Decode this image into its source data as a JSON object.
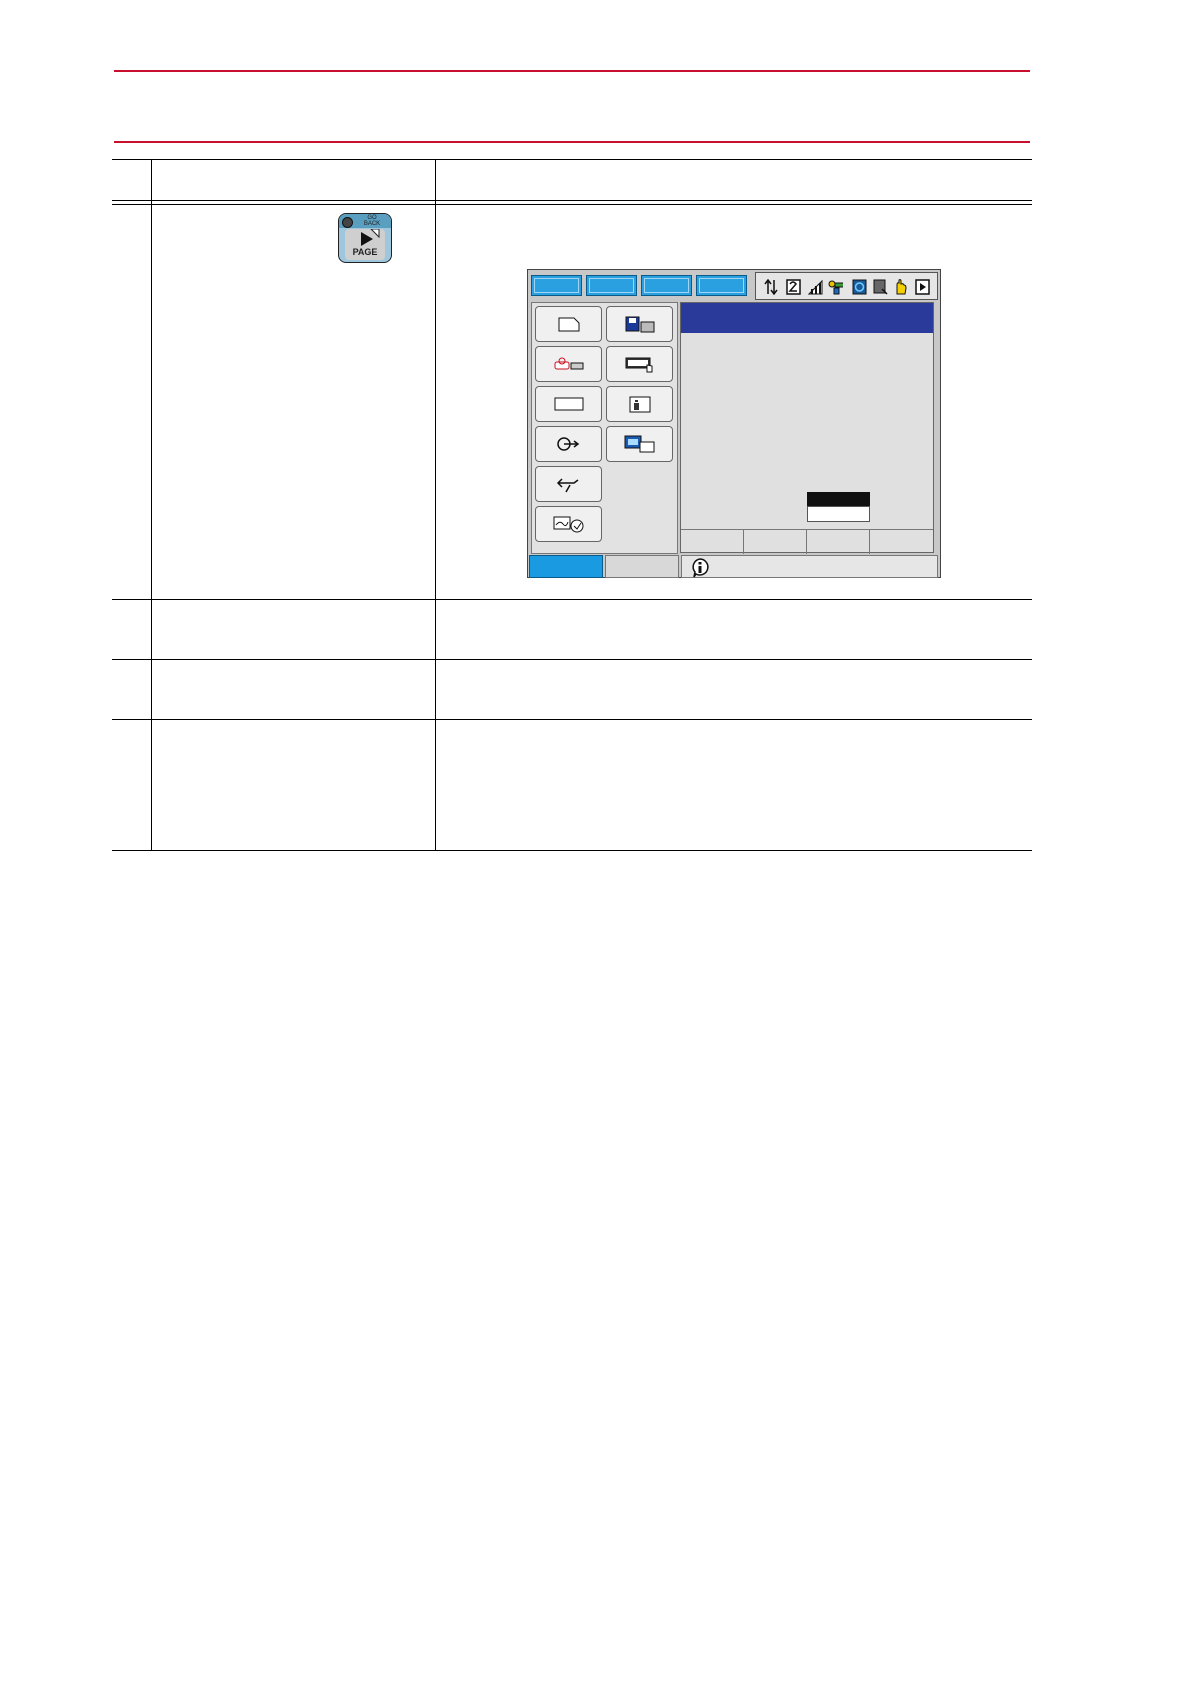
{
  "page_key": {
    "top_label": "GO\nBACK",
    "main_label": "PAGE"
  },
  "colors": {
    "rule": "#c8102e",
    "tab_accent": "#2aa0e0",
    "title_bar": "#2a3a9a"
  },
  "pendant": {
    "status_icons": [
      "arrows-icon",
      "number-icon",
      "signal-icon",
      "robot-icon",
      "servo-icon",
      "document-icon",
      "hand-icon",
      "play-icon"
    ],
    "menu_icons": [
      "new-job-icon",
      "save-disk-icon",
      "robot-arm-icon",
      "keyboard-icon",
      "blank-icon",
      "info-icon",
      "arc-icon",
      "display-icon",
      "tool-icon",
      "monitor-icon"
    ]
  }
}
